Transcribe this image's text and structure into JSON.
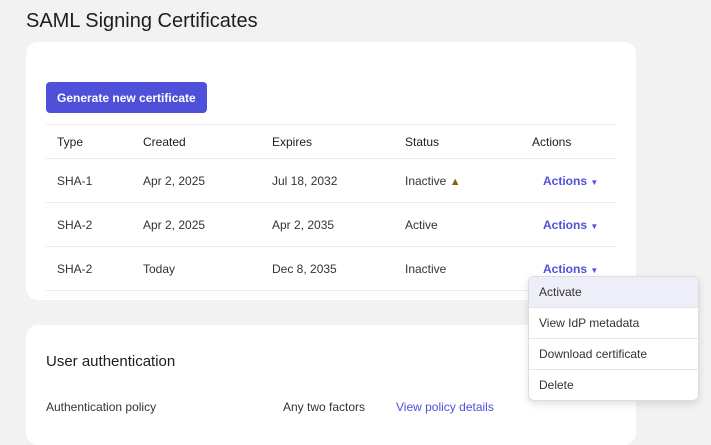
{
  "title": "SAML Signing Certificates",
  "generate_label": "Generate new certificate",
  "columns": [
    "Type",
    "Created",
    "Expires",
    "Status",
    "Actions"
  ],
  "rows": [
    {
      "type": "SHA-1",
      "created": "Apr 2, 2025",
      "expires": "Jul 18, 2032",
      "status": "Inactive",
      "warning": true,
      "action": "Actions"
    },
    {
      "type": "SHA-2",
      "created": "Apr 2, 2025",
      "expires": "Apr 2, 2035",
      "status": "Active",
      "action": "Actions"
    },
    {
      "type": "SHA-2",
      "created": "Today",
      "expires": "Dec 8, 2035",
      "status": "Inactive",
      "action": "Actions"
    }
  ],
  "menu": [
    "Activate",
    "View IdP metadata",
    "Download certificate",
    "Delete"
  ],
  "user_auth": {
    "title": "User authentication",
    "policy_label": "Authentication policy",
    "policy_value": "Any two factors",
    "policy_link": "View policy details"
  },
  "colors": {
    "accent": "#4f50d9",
    "warning": "#8a6412"
  }
}
